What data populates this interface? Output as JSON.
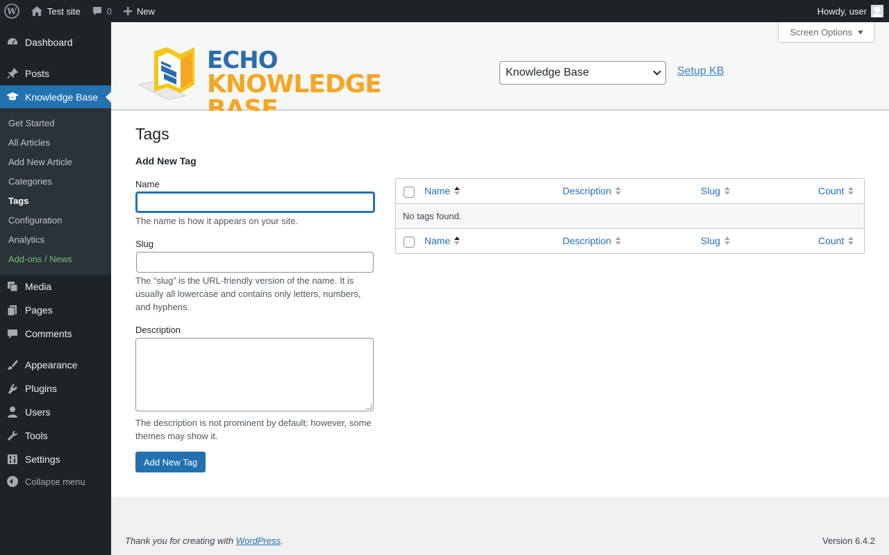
{
  "adminbar": {
    "site_name": "Test site",
    "comments_count": "0",
    "new_label": "New",
    "greeting": "Howdy, user"
  },
  "sidebar": {
    "items": [
      {
        "label": "Dashboard",
        "icon": "dashboard-icon"
      },
      {
        "label": "Posts",
        "icon": "pin-icon"
      },
      {
        "label": "Knowledge Base",
        "icon": "graduation-cap-icon"
      },
      {
        "label": "Media",
        "icon": "media-icon"
      },
      {
        "label": "Pages",
        "icon": "pages-icon"
      },
      {
        "label": "Comments",
        "icon": "comment-icon"
      },
      {
        "label": "Appearance",
        "icon": "brush-icon"
      },
      {
        "label": "Plugins",
        "icon": "plugin-icon"
      },
      {
        "label": "Users",
        "icon": "user-icon"
      },
      {
        "label": "Tools",
        "icon": "wrench-icon"
      },
      {
        "label": "Settings",
        "icon": "settings-icon"
      }
    ],
    "submenu": [
      "Get Started",
      "All Articles",
      "Add New Article",
      "Categories",
      "Tags",
      "Configuration",
      "Analytics",
      "Add-ons / News"
    ],
    "collapse_label": "Collapse menu"
  },
  "header": {
    "screen_options": "Screen Options",
    "logo_line1": "ECHO",
    "logo_line2": "KNOWLEDGE BASE",
    "kb_select_value": "Knowledge Base",
    "setup_link": "Setup KB"
  },
  "main": {
    "page_title": "Tags",
    "form_title": "Add New Tag",
    "name_label": "Name",
    "name_value": "",
    "name_help": "The name is how it appears on your site.",
    "slug_label": "Slug",
    "slug_value": "",
    "slug_help": "The “slug” is the URL-friendly version of the name. It is usually all lowercase and contains only letters, numbers, and hyphens.",
    "description_label": "Description",
    "description_value": "",
    "description_help": "The description is not prominent by default; however, some themes may show it.",
    "submit_label": "Add New Tag"
  },
  "table": {
    "columns": [
      "Name",
      "Description",
      "Slug",
      "Count"
    ],
    "sorted_column": "Name",
    "empty_message": "No tags found."
  },
  "footer": {
    "thanks_prefix": "Thank you for creating with ",
    "thanks_link": "WordPress",
    "thanks_suffix": ".",
    "version": "Version 6.4.2"
  },
  "colors": {
    "admin_dark": "#1d2327",
    "accent_blue": "#2271b1",
    "submenu_bg": "#2c3338",
    "addons_green": "#6bc373",
    "logo_blue": "#2b6cb0",
    "logo_orange": "#f5a623"
  }
}
